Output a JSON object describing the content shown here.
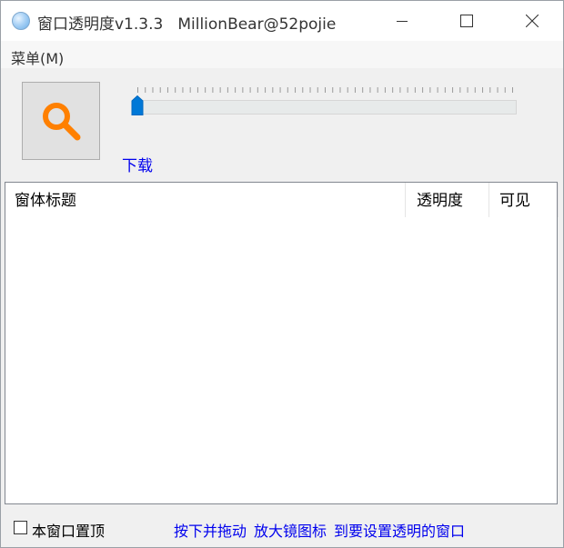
{
  "window": {
    "title": "窗口透明度v1.3.3",
    "author": "MillionBear@52pojie",
    "controls": {
      "minimize_icon": "minimize-icon",
      "maximize_icon": "maximize-icon",
      "close_icon": "close-icon"
    }
  },
  "menu": {
    "items": [
      {
        "label": "菜单(M)"
      }
    ]
  },
  "toolbar": {
    "finder_icon": "magnifier-icon",
    "opacity_slider": {
      "value_fraction": 0.0
    },
    "download_label": "下载"
  },
  "list": {
    "columns": [
      {
        "label": "窗体标题"
      },
      {
        "label": "透明度"
      },
      {
        "label": "可见"
      }
    ],
    "rows": []
  },
  "footer": {
    "checkbox_label": "本窗口置顶",
    "checkbox_checked": false,
    "hint_parts": [
      "按下并拖动",
      "放大镜图标",
      "到要设置透明的窗口"
    ]
  },
  "colors": {
    "accent": "#0078d7",
    "link": "#0000ee",
    "magnifier": "#ff8000"
  }
}
